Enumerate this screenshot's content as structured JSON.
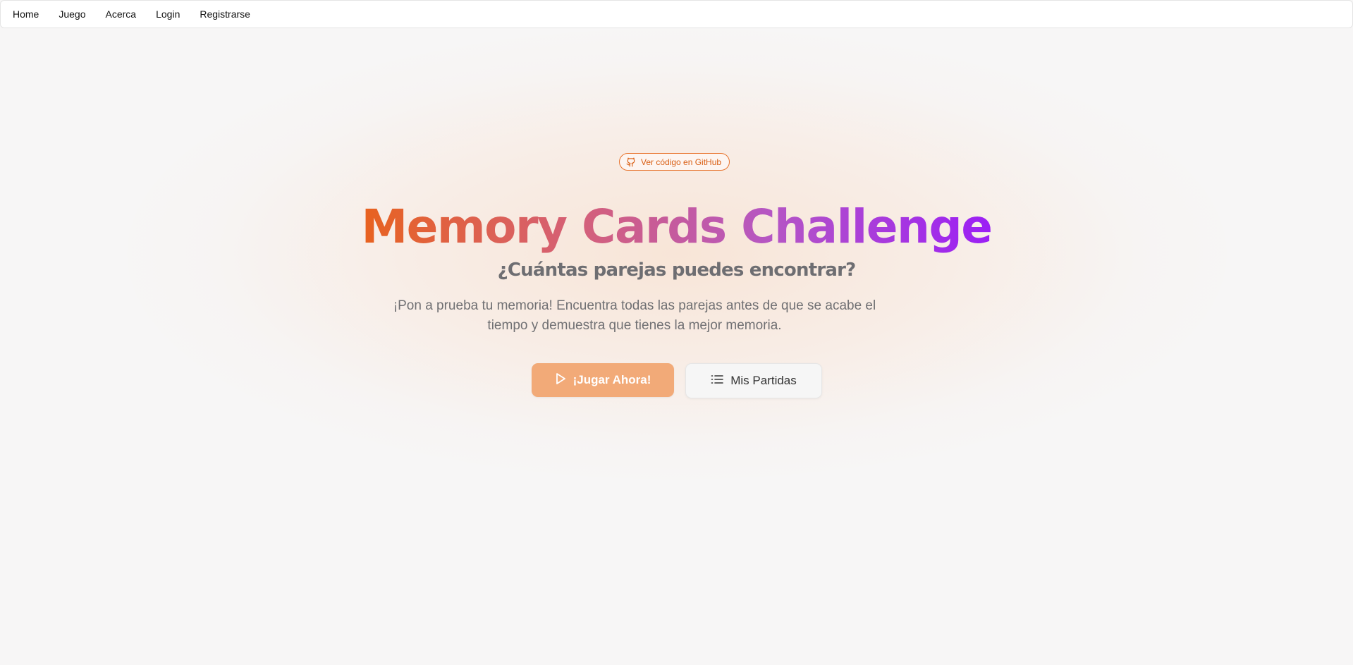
{
  "nav": {
    "items": [
      {
        "label": "Home"
      },
      {
        "label": "Juego"
      },
      {
        "label": "Acerca"
      },
      {
        "label": "Login"
      },
      {
        "label": "Registrarse"
      }
    ]
  },
  "hero": {
    "badge": {
      "label": "Ver código en GitHub",
      "icon": "github-icon"
    },
    "title": "Memory Cards Challenge",
    "subtitle": "¿Cuántas parejas puedes encontrar?",
    "description": "¡Pon a prueba tu memoria! Encuentra todas las parejas antes de que se acabe el tiempo y demuestra que tienes la mejor memoria.",
    "primary_button": {
      "label": "¡Jugar Ahora!",
      "icon": "play-icon"
    },
    "secondary_button": {
      "label": "Mis Partidas",
      "icon": "list-icon"
    }
  },
  "colors": {
    "accent": "#e8742e",
    "primary_button": "#f2aa78",
    "title_gradient_start": "#e8621f",
    "title_gradient_end": "#9b1ff5",
    "background": "#f7f6f6"
  }
}
